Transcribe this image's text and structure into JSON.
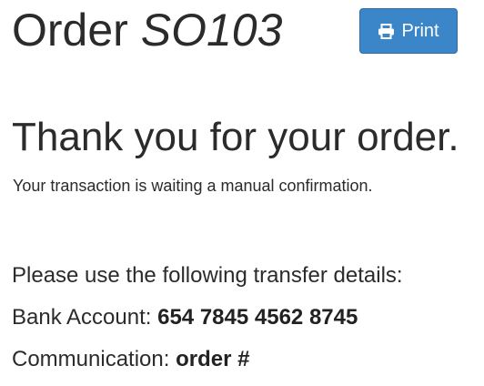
{
  "header": {
    "title_prefix": "Order",
    "order_ref": "SO103",
    "print_label": "Print",
    "print_icon": "printer-icon",
    "button_color": "#3a86c8"
  },
  "confirmation": {
    "heading": "Thank you for your order.",
    "status_message": "Your transaction is waiting a manual confirmation."
  },
  "transfer": {
    "intro": "Please use the following transfer details:",
    "bank_account_label": "Bank Account:",
    "bank_account_value": "654 7845 4562 8745",
    "communication_label": "Communication:",
    "communication_value": "order #"
  }
}
